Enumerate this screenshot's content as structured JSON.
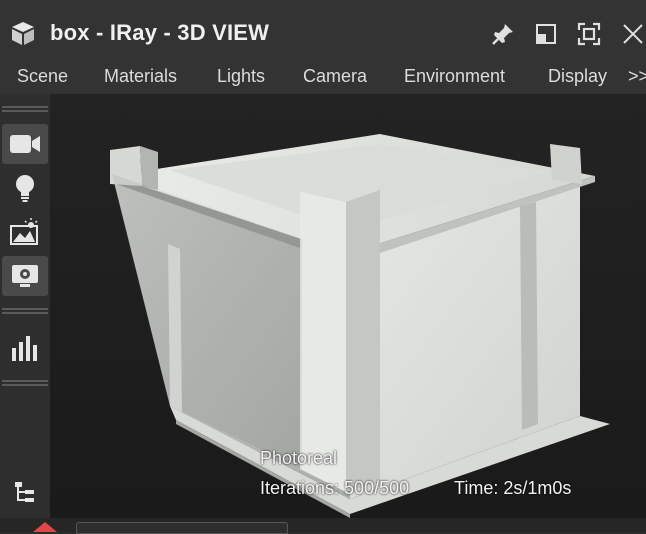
{
  "window": {
    "title": "box - IRay - 3D VIEW",
    "icons": [
      "cube-icon",
      "pin-icon",
      "restore-icon",
      "fullscreen-icon",
      "close-icon"
    ]
  },
  "menu": {
    "items": [
      {
        "label": "Scene"
      },
      {
        "label": "Materials"
      },
      {
        "label": "Lights"
      },
      {
        "label": "Camera"
      },
      {
        "label": "Environment"
      },
      {
        "label": "Display"
      }
    ],
    "more": ">>"
  },
  "sidebar": {
    "buttons": [
      {
        "icon": "camera-icon",
        "active": true
      },
      {
        "icon": "lightbulb-icon",
        "active": false
      },
      {
        "icon": "environment-image-icon",
        "active": false
      },
      {
        "icon": "display-settings-icon",
        "active": true
      },
      {
        "icon": "histogram-icon",
        "active": false
      },
      {
        "icon": "scene-tree-icon",
        "active": false
      }
    ]
  },
  "viewport": {
    "mode": "Photoreal",
    "iterations": "Iterations: 500/500",
    "time": "Time: 2s/1m0s"
  },
  "bottom": {
    "tab_label": "",
    "accent": "#e04848"
  },
  "colors": {
    "titlebar": "#333333",
    "viewport_bg": "#1f1f1f",
    "active_button": "#4a4a4a"
  }
}
